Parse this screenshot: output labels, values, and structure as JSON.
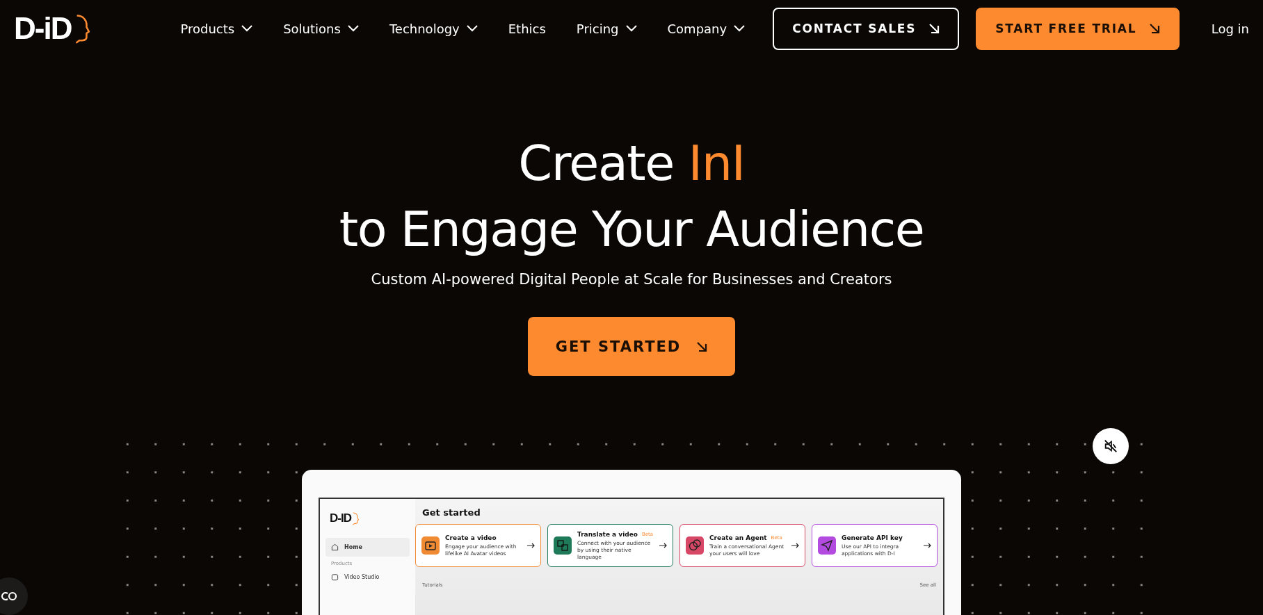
{
  "header": {
    "logo": "D-iD",
    "nav": [
      {
        "label": "Products",
        "dropdown": true
      },
      {
        "label": "Solutions",
        "dropdown": true
      },
      {
        "label": "Technology",
        "dropdown": true
      },
      {
        "label": "Ethics",
        "dropdown": false
      },
      {
        "label": "Pricing",
        "dropdown": true
      },
      {
        "label": "Company",
        "dropdown": true
      }
    ],
    "buttons": [
      {
        "label": "CONTACT SALES",
        "kind": "outline"
      },
      {
        "label": "START FREE TRIAL",
        "kind": "filled"
      }
    ],
    "login": "Log in"
  },
  "hero": {
    "title_prefix": "Create ",
    "title_highlight": "InI",
    "title_line2": "to Engage Your Audience",
    "subtitle": "Custom AI-powered Digital People at Scale for Businesses and Creators",
    "cta": "GET STARTED"
  },
  "video": {
    "muted": true,
    "app": {
      "logo": "D-ID",
      "sidebar": [
        {
          "kind": "item",
          "label": "Home",
          "selected": true
        },
        {
          "kind": "heading",
          "label": "Products"
        },
        {
          "kind": "item",
          "label": "Video Studio",
          "selected": false
        }
      ],
      "heading": "Get started",
      "cards": [
        {
          "title": "Create a video",
          "desc": "Engage your audience with lifelike AI Avatar videos",
          "color": "#f08a33"
        },
        {
          "title": "Translate a video",
          "badge": "Beta",
          "desc": "Connect with your audience by using their native language",
          "color": "#1f7a5a"
        },
        {
          "title": "Create an Agent",
          "badge": "Beta",
          "desc": "Train a conversational Agent your users will love",
          "color": "#d94766"
        },
        {
          "title": "Generate API key",
          "desc": "Use our API to integra applications with D-I",
          "color": "#b34be0"
        }
      ],
      "section": "Tutorials",
      "see_all": "See all"
    }
  }
}
